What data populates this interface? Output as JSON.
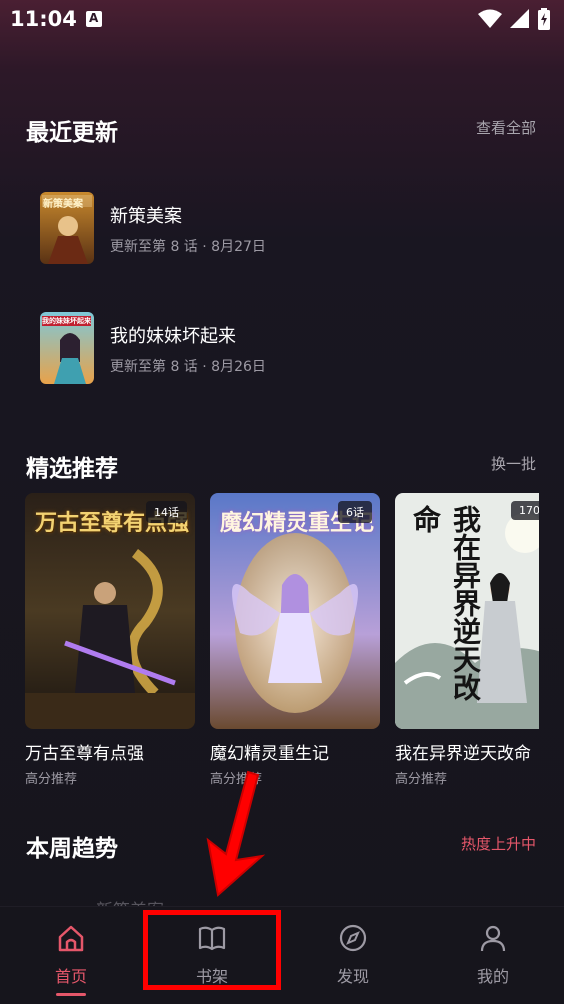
{
  "status_bar": {
    "time": "11:04",
    "a_icon": "notification-a-icon"
  },
  "recent": {
    "title": "最近更新",
    "link": "查看全部",
    "items": [
      {
        "title": "新策美案",
        "episode": "更新至第 8 话",
        "date": "8月27日",
        "thumb_text": "新策美案"
      },
      {
        "title": "我的妹妹坏起来",
        "episode": "更新至第 8 话",
        "date": "8月26日",
        "thumb_text": "我的妹妹坏起来"
      }
    ]
  },
  "featured": {
    "title": "精选推荐",
    "link": "换一批",
    "cards": [
      {
        "title": "万古至尊有点强",
        "sub": "高分推荐",
        "badge": "14话",
        "cover_text": "万古至尊有点强"
      },
      {
        "title": "魔幻精灵重生记",
        "sub": "高分推荐",
        "badge": "6话",
        "cover_text": "魔幻精灵重生记"
      },
      {
        "title": "我在异界逆天改命",
        "sub": "高分推荐",
        "badge": "170",
        "cover_text": "我在异界逆天改命"
      }
    ]
  },
  "trending": {
    "title": "本周趋势",
    "link": "热度上升中",
    "partial_item": "新策美案"
  },
  "nav": {
    "items": [
      {
        "label": "首页",
        "icon": "home-icon",
        "active": true
      },
      {
        "label": "书架",
        "icon": "book-icon",
        "active": false
      },
      {
        "label": "发现",
        "icon": "compass-icon",
        "active": false
      },
      {
        "label": "我的",
        "icon": "user-icon",
        "active": false
      }
    ]
  },
  "colors": {
    "accent": "#e5576a",
    "annotation": "#ff0000"
  }
}
